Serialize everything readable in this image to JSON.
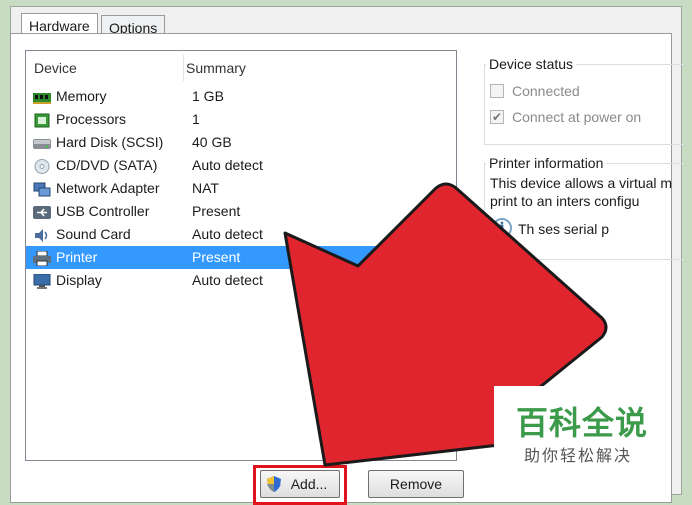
{
  "tabs": [
    {
      "label": "Hardware",
      "active": true
    },
    {
      "label": "Options",
      "active": false
    }
  ],
  "device_list": {
    "columns": [
      "Device",
      "Summary"
    ],
    "rows": [
      {
        "icon": "memory-icon",
        "device": "Memory",
        "summary": "1 GB",
        "selected": false
      },
      {
        "icon": "processor-icon",
        "device": "Processors",
        "summary": "1",
        "selected": false
      },
      {
        "icon": "hard-disk-icon",
        "device": "Hard Disk (SCSI)",
        "summary": "40 GB",
        "selected": false
      },
      {
        "icon": "cd-dvd-icon",
        "device": "CD/DVD (SATA)",
        "summary": "Auto detect",
        "selected": false
      },
      {
        "icon": "network-adapter-icon",
        "device": "Network Adapter",
        "summary": "NAT",
        "selected": false
      },
      {
        "icon": "usb-icon",
        "device": "USB Controller",
        "summary": "Present",
        "selected": false
      },
      {
        "icon": "sound-card-icon",
        "device": "Sound Card",
        "summary": "Auto detect",
        "selected": false
      },
      {
        "icon": "printer-icon",
        "device": "Printer",
        "summary": "Present",
        "selected": true
      },
      {
        "icon": "display-icon",
        "device": "Display",
        "summary": "Auto detect",
        "selected": false
      }
    ]
  },
  "device_status": {
    "title": "Device status",
    "connected_label": "Connected",
    "connected_checked": false,
    "connect_at_power_on_label": "Connect at power on",
    "connect_at_power_on_checked": true
  },
  "printer_information": {
    "title": "Printer information",
    "line1": "This device allows a virtual m",
    "line2": "print to an  inters configu",
    "note": "Th                    ses serial p"
  },
  "buttons": {
    "add_label": "Add...",
    "remove_label": "Remove"
  },
  "watermark": {
    "title": "百科全说",
    "subtitle": "助你轻松解决"
  },
  "colors": {
    "selection": "#3399ff",
    "arrow": "#e0252e",
    "highlight": "#e0121b",
    "watermark_green": "#3c9a4b"
  }
}
